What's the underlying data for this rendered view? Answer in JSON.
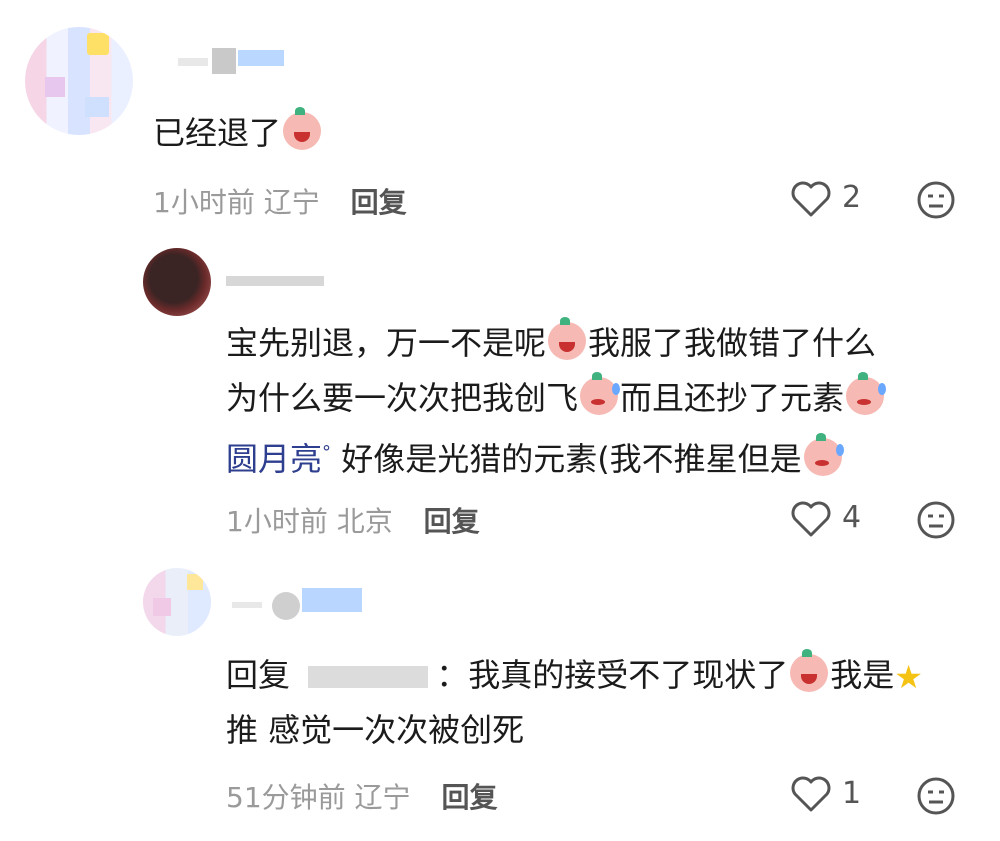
{
  "comments": [
    {
      "text_parts": [
        "已经退了"
      ],
      "time": "1小时前",
      "location": "辽宁",
      "reply_label": "回复",
      "likes": "2"
    },
    {
      "text_lines": [
        "宝先别退，万一不是呢",
        "我服了我做错了什么",
        "为什么要一次次把我创飞",
        "而且还抄了元素",
        "圆月亮",
        "好像是光猎的元素(我不推星但是"
      ],
      "time": "1小时前",
      "location": "北京",
      "reply_label": "回复",
      "likes": "4"
    },
    {
      "prefix": "回复",
      "colon": "：",
      "text_parts": [
        "我真的接受不了现状了",
        "我是",
        "推 感觉一次次被创死"
      ],
      "time": "51分钟前",
      "location": "辽宁",
      "reply_label": "回复",
      "likes": "1"
    }
  ],
  "icons": {
    "like": "heart-icon",
    "react": "neutral-face-icon",
    "emoji": "sticker-face-icon",
    "star": "star-icon"
  },
  "colors": {
    "meta": "#9a9a9a",
    "mention": "#2f3f8f",
    "text": "#1b1b1b"
  }
}
